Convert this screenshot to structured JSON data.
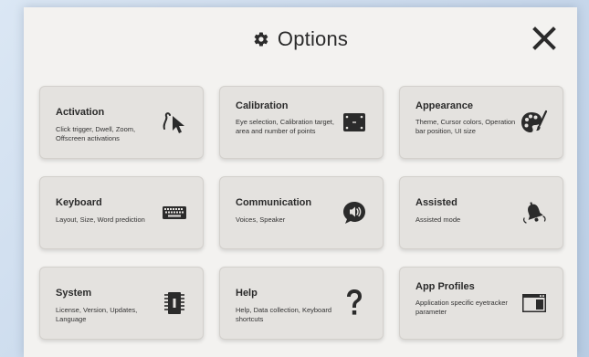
{
  "header": {
    "title": "Options",
    "title_icon": "gear-icon",
    "close_icon": "close-icon"
  },
  "colors": {
    "background": "#cfdcea",
    "panel": "#f3f2f0",
    "card": "#e4e2df",
    "text": "#2b2b2b"
  },
  "cards": [
    {
      "title": "Activation",
      "description": "Click trigger, Dwell, Zoom, Offscreen activations",
      "icon": "pointer-gesture-icon"
    },
    {
      "title": "Calibration",
      "description": "Eye selection, Calibration target, area and number of points",
      "icon": "calibration-screen-icon"
    },
    {
      "title": "Appearance",
      "description": "Theme, Cursor colors, Operation bar position, UI size",
      "icon": "palette-brush-icon"
    },
    {
      "title": "Keyboard",
      "description": "Layout, Size, Word prediction",
      "icon": "keyboard-icon"
    },
    {
      "title": "Communication",
      "description": "Voices, Speaker",
      "icon": "speech-speaker-icon"
    },
    {
      "title": "Assisted",
      "description": "Assisted mode",
      "icon": "bell-ringing-icon"
    },
    {
      "title": "System",
      "description": "License, Version, Updates, Language",
      "icon": "chip-icon"
    },
    {
      "title": "Help",
      "description": "Help, Data collection, Keyboard shortcuts",
      "icon": "question-mark-icon"
    },
    {
      "title": "App Profiles",
      "description": "Application specific eyetracker parameter",
      "icon": "app-window-icon"
    }
  ]
}
